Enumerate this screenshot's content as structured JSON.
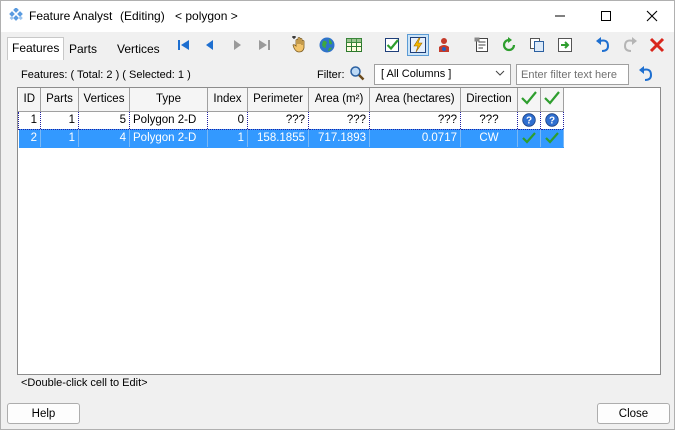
{
  "window": {
    "title": "Feature Analyst",
    "mode": "(Editing)",
    "layer": "< polygon >"
  },
  "tabs": [
    {
      "label": "Features",
      "active": true
    },
    {
      "label": "Parts",
      "active": false
    },
    {
      "label": "Vertices",
      "active": false
    }
  ],
  "status": {
    "counts": "Features: ( Total: 2 ) ( Selected: 1 )",
    "hint": "<Double-click cell to Edit>"
  },
  "filter": {
    "label": "Filter:",
    "selected": "[ All Columns ]",
    "placeholder": "Enter filter text here"
  },
  "table": {
    "columns": [
      "ID",
      "Parts",
      "Vertices",
      "Type",
      "Index",
      "Perimeter",
      "Area (m²)",
      "Area (hectares)",
      "Direction"
    ],
    "rows": [
      [
        "1",
        "1",
        "5",
        "Polygon 2-D",
        "0",
        "???",
        "???",
        "???",
        "???"
      ],
      [
        "2",
        "1",
        "4",
        "Polygon 2-D",
        "1",
        "158.1855",
        "717.1893",
        "0.0717",
        "CW"
      ]
    ]
  },
  "buttons": {
    "help": "Help",
    "close": "Close"
  },
  "colors": {
    "selection": "#3399ff",
    "accent_blue": "#1e6fd0",
    "check_green": "#2e9e2e",
    "delete_red": "#d9261c"
  }
}
